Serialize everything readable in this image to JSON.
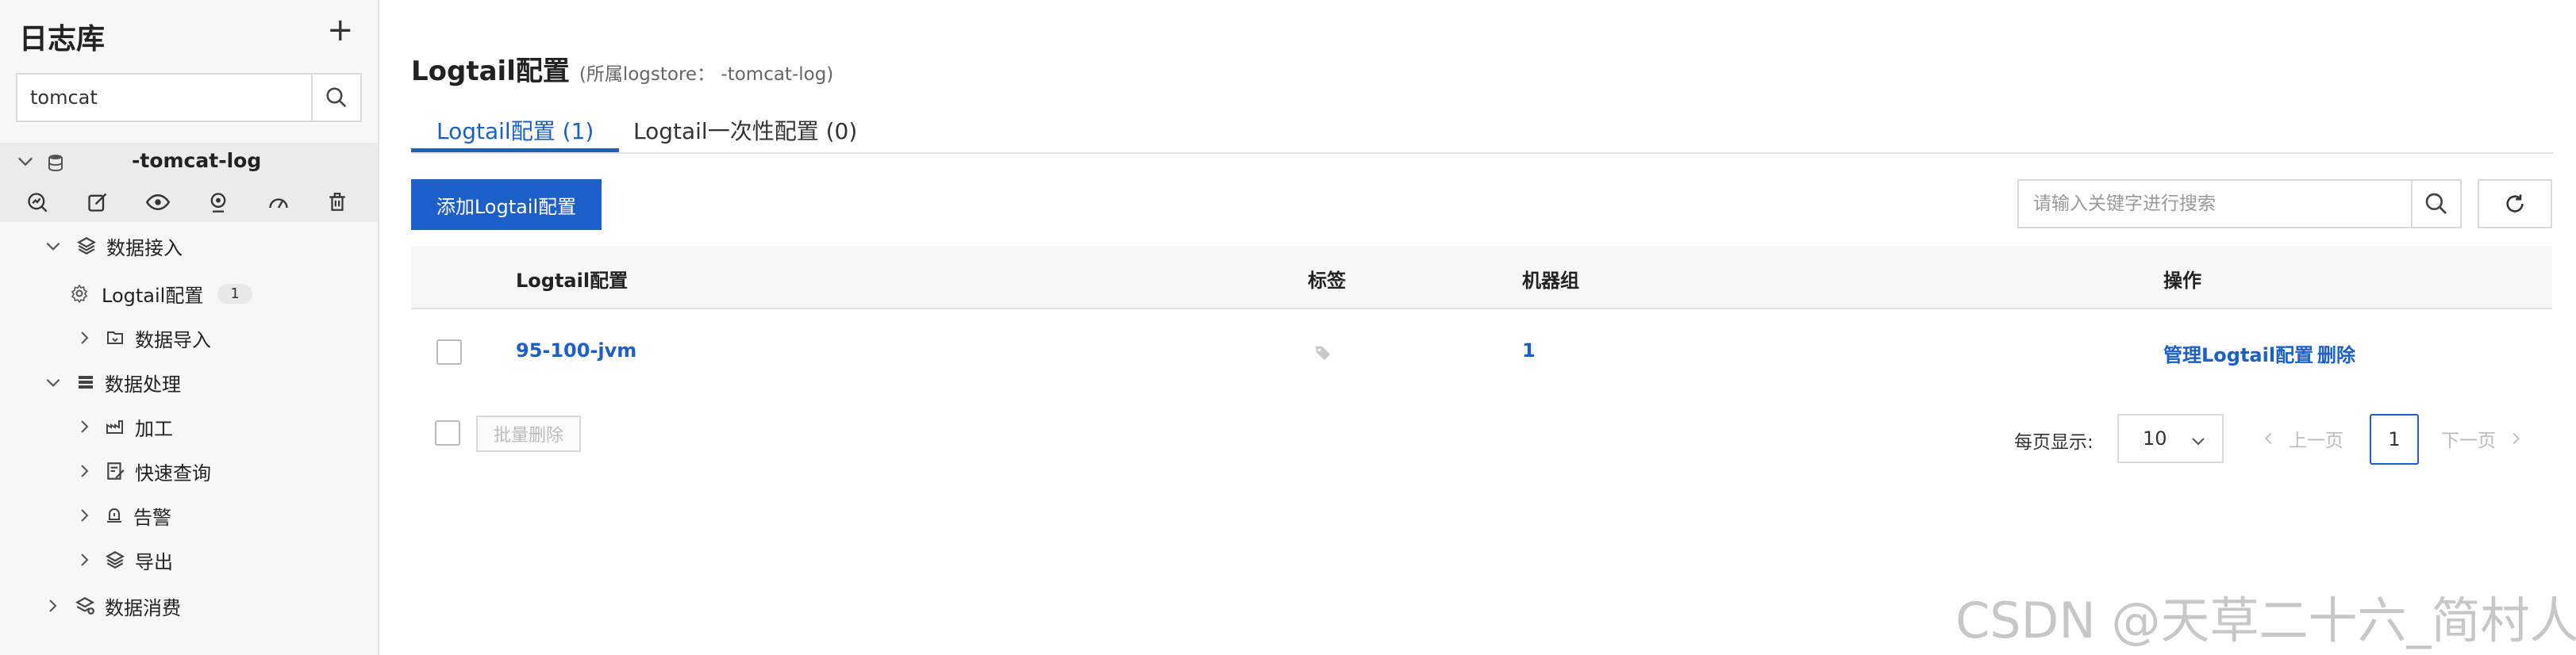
{
  "sidebar": {
    "title": "日志库",
    "search_value": "tomcat",
    "logstore_name": "-tomcat-log",
    "tools": [
      "search-analyze-icon",
      "edit-icon",
      "eye-icon",
      "location-icon",
      "dashboard-icon",
      "trash-icon"
    ],
    "tree": {
      "data_ingest": "数据接入",
      "logtail_config": "Logtail配置",
      "logtail_count": "1",
      "data_import": "数据导入",
      "data_process": "数据处理",
      "transform": "加工",
      "quick_query": "快速查询",
      "alert": "告警",
      "export": "导出",
      "data_consume": "数据消费"
    }
  },
  "main": {
    "title": "Logtail配置",
    "subtitle": "(所属logstore：       -tomcat-log)",
    "tabs": [
      {
        "label": "Logtail配置 (1)",
        "active": true
      },
      {
        "label": "Logtail一次性配置 (0)",
        "active": false
      }
    ],
    "add_button": "添加Logtail配置",
    "search_placeholder": "请输入关键字进行搜索",
    "columns": {
      "config": "Logtail配置",
      "tags": "标签",
      "machine_group": "机器组",
      "actions": "操作"
    },
    "rows": [
      {
        "config": "95-100-jvm",
        "machine_group": "1",
        "manage": "管理Logtail配置",
        "delete": "删除"
      }
    ],
    "batch_delete": "批量删除",
    "pagination": {
      "per_page_label": "每页显示:",
      "per_page": "10",
      "prev": "上一页",
      "current": "1",
      "next": "下一页"
    }
  },
  "watermark": "CSDN @天草二十六_简村人",
  "colors": {
    "accent": "#1b5fc7",
    "primary_button": "#1c5fc9"
  }
}
